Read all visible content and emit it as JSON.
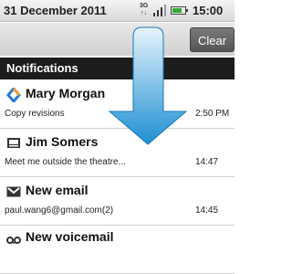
{
  "statusbar": {
    "date": "31 December 2011",
    "network_top": "3G",
    "network_bottom": "↑↓",
    "time": "15:00",
    "battery_level": 0.8
  },
  "clear_label": "Clear",
  "notifications_header": "Notifications",
  "items": [
    {
      "title": "Mary Morgan",
      "desc": "Copy revisions",
      "time": "2:50 PM",
      "icon": "sync-icon"
    },
    {
      "title": "Jim Somers",
      "desc": "Meet me outside the theatre...",
      "time": "14:47",
      "icon": "message-icon"
    },
    {
      "title": "New email",
      "desc": "paul.wang6@gmail.com(2)",
      "time": "14:45",
      "icon": "gmail-icon"
    },
    {
      "title": "New voicemail",
      "desc": "",
      "time": "",
      "icon": "voicemail-icon"
    }
  ],
  "colors": {
    "arrow_top": "#e6f4fc",
    "arrow_bottom": "#1e8fd2"
  }
}
